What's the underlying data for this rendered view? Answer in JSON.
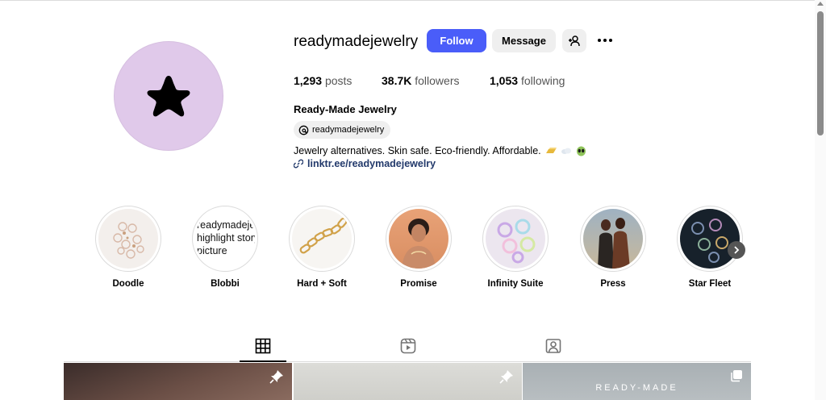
{
  "profile": {
    "username": "readymadejewelry",
    "follow_label": "Follow",
    "message_label": "Message",
    "full_name": "Ready-Made Jewelry",
    "threads_handle": "readymadejewelry",
    "bio": "Jewelry alternatives. Skin safe. Eco-friendly. Affordable.",
    "link": "linktr.ee/readymadejewelry",
    "avatar_color": "#e0c9ea"
  },
  "stats": {
    "posts_count": "1,293",
    "posts_label": "posts",
    "followers_count": "38.7K",
    "followers_label": "followers",
    "following_count": "1,053",
    "following_label": "following"
  },
  "highlights": [
    {
      "label": "Doodle",
      "icon": "jewelry-charms"
    },
    {
      "label": "Blobbi",
      "icon": "broken-image-alt-text",
      "alt_text": "readymadejewelry highlight story picture"
    },
    {
      "label": "Hard + Soft",
      "icon": "gold-chain"
    },
    {
      "label": "Promise",
      "icon": "portrait"
    },
    {
      "label": "Infinity Suite",
      "icon": "pastel-rings"
    },
    {
      "label": "Press",
      "icon": "couple-photo"
    },
    {
      "label": "Star Fleet",
      "icon": "dark-rings"
    }
  ],
  "tabs": [
    {
      "name": "posts",
      "icon": "grid-icon",
      "active": true
    },
    {
      "name": "reels",
      "icon": "reels-icon",
      "active": false
    },
    {
      "name": "tagged",
      "icon": "tagged-icon",
      "active": false
    }
  ],
  "posts": [
    {
      "icon": "pin-icon"
    },
    {
      "icon": "pin-icon"
    },
    {
      "icon": "carousel-icon",
      "overlay_text": "READY-MADE"
    }
  ],
  "colors": {
    "accent": "#4a5df9",
    "link": "#22396b"
  }
}
